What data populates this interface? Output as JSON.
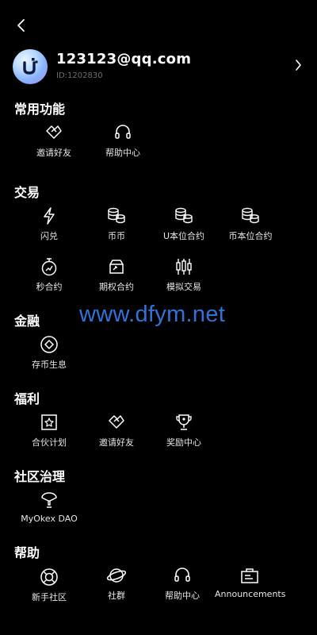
{
  "profile": {
    "email": "123123@qq.com",
    "uid": "ID:1202830"
  },
  "sections": {
    "common": {
      "title": "常用功能",
      "items": [
        "邀请好友",
        "帮助中心"
      ]
    },
    "trade": {
      "title": "交易",
      "items": [
        "闪兑",
        "币币",
        "U本位合约",
        "币本位合约",
        "秒合约",
        "期权合约",
        "模拟交易"
      ]
    },
    "finance": {
      "title": "金融",
      "items": [
        "存币生息"
      ]
    },
    "welfare": {
      "title": "福利",
      "items": [
        "合伙计划",
        "邀请好友",
        "奖励中心"
      ]
    },
    "community": {
      "title": "社区治理",
      "items": [
        "MyOkex DAO"
      ]
    },
    "help": {
      "title": "帮助",
      "items": [
        "新手社区",
        "社群",
        "帮助中心",
        "Announcements"
      ]
    }
  },
  "watermark": "www.dfym.net",
  "icons": [
    "back-icon",
    "chevron-right-icon",
    "invite-icon",
    "headset-icon",
    "flash-icon",
    "coins-icon",
    "timer-icon",
    "option-icon",
    "candlestick-icon",
    "deposit-icon",
    "star-box-icon",
    "trophy-icon",
    "dao-icon",
    "lifebuoy-icon",
    "planet-icon",
    "announcement-icon"
  ],
  "colors": {
    "background": "#000000",
    "text": "#ffffff",
    "muted": "#6e6e6e",
    "watermark": "#2f72d8"
  }
}
